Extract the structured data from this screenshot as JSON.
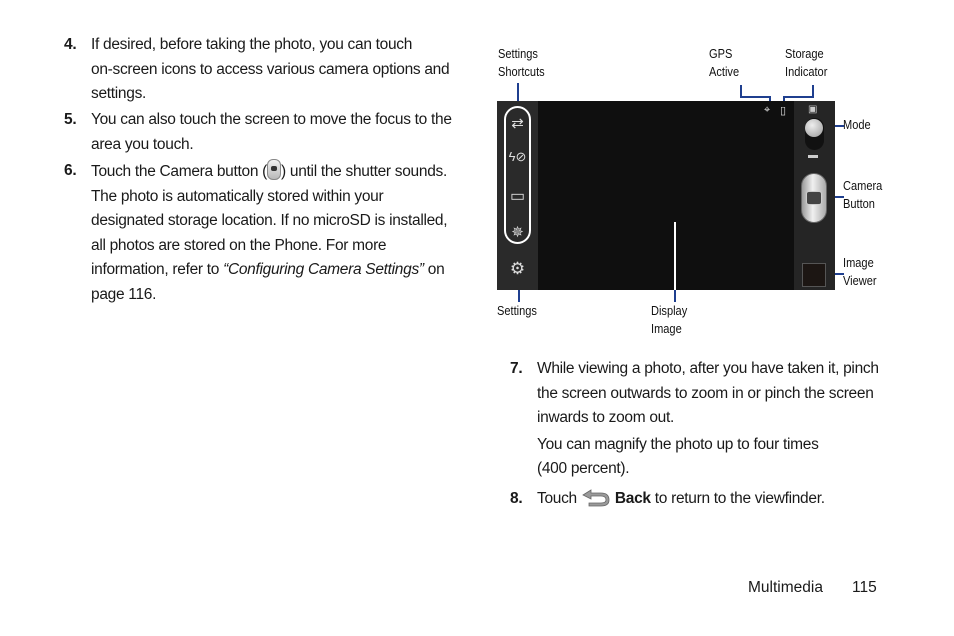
{
  "left_steps": [
    {
      "num": "4.",
      "lines": [
        "If desired, before taking the photo, you can touch",
        "on-screen icons to access various camera options and",
        "settings."
      ]
    },
    {
      "num": "5.",
      "lines": [
        "You can also touch the screen to move the focus to the",
        "area you touch."
      ]
    },
    {
      "num": "6.",
      "line1_pre": "Touch the Camera button (",
      "line1_post": ") until the shutter sounds.",
      "lines": [
        "The photo is automatically stored within your",
        "designated storage location. If no microSD is installed,",
        "all photos are stored on the Phone. For more"
      ],
      "ref_pre": "information, refer to ",
      "ref_title": "“Configuring Camera Settings”",
      "ref_post": " on",
      "last": "page 116."
    }
  ],
  "diagram": {
    "labels": {
      "settings_shortcuts": [
        "Settings",
        "Shortcuts"
      ],
      "gps_active": [
        "GPS",
        "Active"
      ],
      "storage_indicator": [
        "Storage",
        "Indicator"
      ],
      "mode": [
        "Mode"
      ],
      "camera_button": [
        "Camera",
        "Button"
      ],
      "image_viewer": [
        "Image",
        "Viewer"
      ],
      "settings": [
        "Settings"
      ],
      "display_image": [
        "Display",
        "Image"
      ]
    },
    "icons": {
      "shortcut_1": "⇄",
      "shortcut_2": "ϟ⊘",
      "shortcut_3": "▭",
      "shortcut_4": "✵",
      "settings": "⚙",
      "gps": "⌖",
      "storage": "▯",
      "camera_mode": "▣",
      "video_mode": "▬"
    },
    "callout_color": "#1f3f8f"
  },
  "right_steps": [
    {
      "num": "7.",
      "lines": [
        "While viewing a photo, after you have taken it, pinch",
        "the screen outwards to zoom in or pinch the screen",
        "inwards to zoom out."
      ],
      "note": [
        "You can magnify the photo up to four times",
        "(400 percent)."
      ]
    },
    {
      "num": "8.",
      "pre": "Touch ",
      "bold": "Back",
      "post": " to return to the viewfinder."
    }
  ],
  "footer": {
    "section": "Multimedia",
    "page": "115"
  }
}
